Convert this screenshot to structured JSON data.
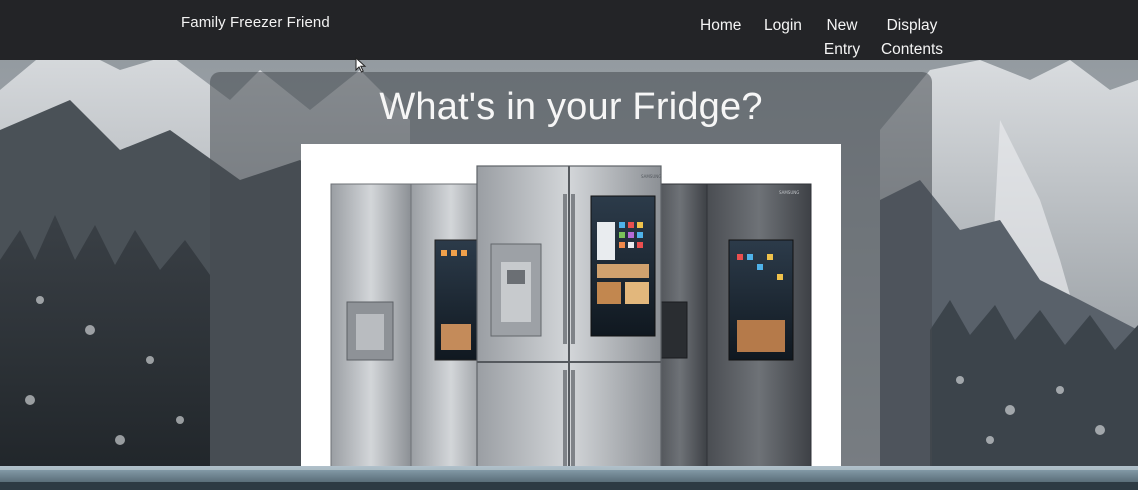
{
  "navbar": {
    "brand": "Family Freezer Friend",
    "links": [
      {
        "label": "Home"
      },
      {
        "label": "Login"
      },
      {
        "label_line1": "New",
        "label_line2": "Entry"
      },
      {
        "label_line1": "Display",
        "label_line2": "Contents"
      }
    ]
  },
  "main": {
    "title": "What's in your Fridge?",
    "image_brand": "SAMSUNG"
  },
  "colors": {
    "navbar_bg": "#232427",
    "nav_text": "#f4f4f4",
    "card_overlay": "rgba(70,74,80,0.55)",
    "image_bg": "#ffffff"
  },
  "icons": [
    "cursor-arrow-icon"
  ]
}
